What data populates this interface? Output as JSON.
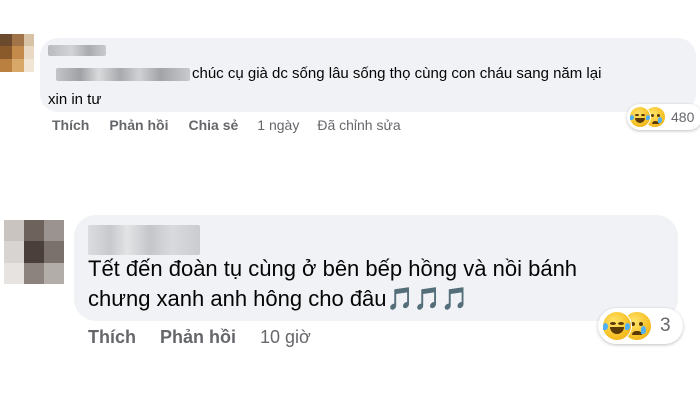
{
  "comments": [
    {
      "text_lines": [
        "chúc cụ già dc sống lâu sống thọ cùng con cháu sang năm lại",
        "xin in tư"
      ],
      "actions": {
        "like": "Thích",
        "reply": "Phản hồi",
        "share": "Chia sẻ",
        "time": "1 ngày",
        "edited": "Đã chỉnh sửa"
      },
      "reaction_count": "480",
      "reaction_icons": [
        "laughing-emoji-icon",
        "crying-emoji-icon"
      ]
    },
    {
      "text_lines": [
        "Tết đến đoàn tụ cùng ở bên bếp hồng và nồi bánh",
        "chưng xanh anh hông cho đâu🎵🎵🎵"
      ],
      "actions": {
        "like": "Thích",
        "reply": "Phản hồi",
        "time": "10 giờ"
      },
      "reaction_count": "3",
      "reaction_icons": [
        "laughing-emoji-icon",
        "crying-emoji-icon"
      ]
    }
  ],
  "colors": {
    "bubble": "#f0f2f5",
    "secondary_text": "#65676b",
    "primary_text": "#050505"
  }
}
